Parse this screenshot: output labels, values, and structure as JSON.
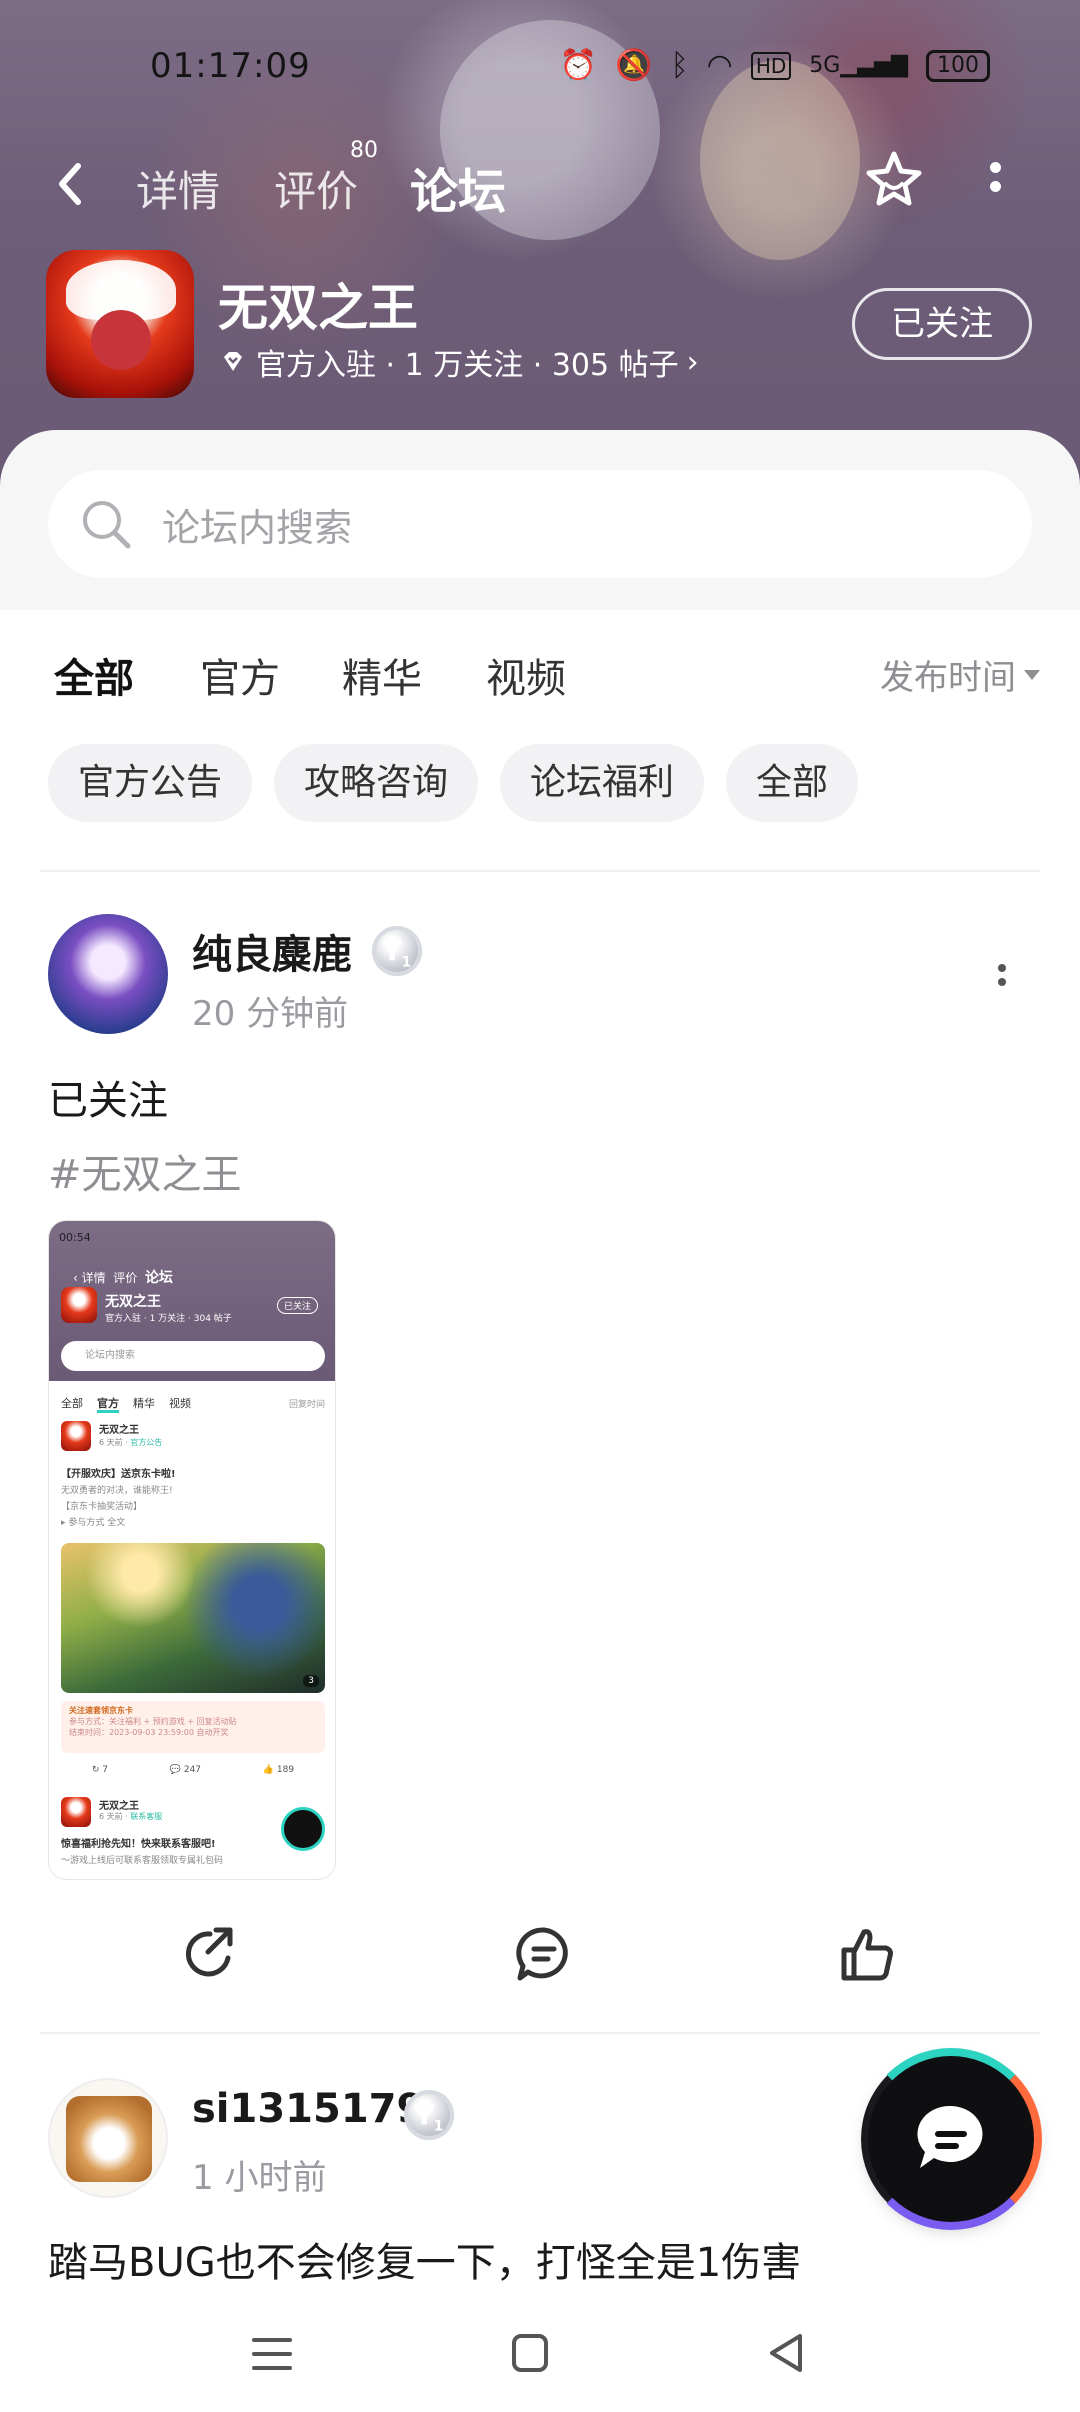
{
  "status_bar": {
    "time": "01:17:09",
    "icons": [
      "alarm-icon",
      "mute-icon",
      "bluetooth-icon",
      "wifi-icon",
      "hd-icon",
      "5g-signal-icon"
    ],
    "hd": "HD",
    "network": "5G",
    "battery": "100"
  },
  "nav": {
    "tabs": [
      {
        "label": "详情"
      },
      {
        "label": "评价",
        "badge": "80"
      },
      {
        "label": "论坛"
      }
    ],
    "active_tab": "论坛",
    "accent": "#2cd3c1"
  },
  "app": {
    "title": "无双之王",
    "meta": "官方入驻 · 1 万关注 · 305 帖子",
    "follow_label": "已关注"
  },
  "search": {
    "placeholder": "论坛内搜索"
  },
  "filter_tabs": [
    "全部",
    "官方",
    "精华",
    "视频"
  ],
  "active_filter": "全部",
  "sort_label": "发布时间",
  "chips": [
    "官方公告",
    "攻略咨询",
    "论坛福利",
    "全部"
  ],
  "posts": [
    {
      "username": "纯良麋鹿",
      "level": "T",
      "level_sub": "1",
      "time": "20 分钟前",
      "text": "已关注",
      "tag": "#无双之王",
      "screenshot": {
        "time": "00:54",
        "nav": [
          "详情",
          "评价",
          "论坛"
        ],
        "title": "无双之王",
        "meta": "官方入驻 · 1 万关注 · 304 帖子",
        "follow": "已关注",
        "search": "论坛内搜索",
        "tabs": [
          "全部",
          "官方",
          "精华",
          "视频"
        ],
        "sort": "回复时间",
        "post_name": "无双之王",
        "post_time": "6 天前",
        "post_tag": "官方公告",
        "line1": "【开服欢庆】送京东卡啦!",
        "line2": "无双勇者的对决，谁能称王!",
        "line3": "【京东卡抽奖活动】",
        "line4": "▸ 参与方式  全文",
        "image_count": "3",
        "card_title": "关注速套领京东卡",
        "card_line": "参与方式：关注福利 + 预约游戏 + 回复活动贴",
        "card_date": "结束时间：2023-09-03 23:59:00 自动开奖",
        "shares": "7",
        "comments": "247",
        "likes": "189",
        "post2_name": "无双之王",
        "post2_time": "6 天前",
        "post2_tag": "联系客服",
        "post2_line1": "惊喜福利抢先知！快来联系客服吧!",
        "post2_line2": "～游戏上线后可联系客服领取专属礼包码"
      }
    },
    {
      "username": "si1315179",
      "level": "T",
      "level_sub": "1",
      "time": "1 小时前",
      "text": "踏马BUG也不会修复一下，打怪全是1伤害"
    }
  ]
}
